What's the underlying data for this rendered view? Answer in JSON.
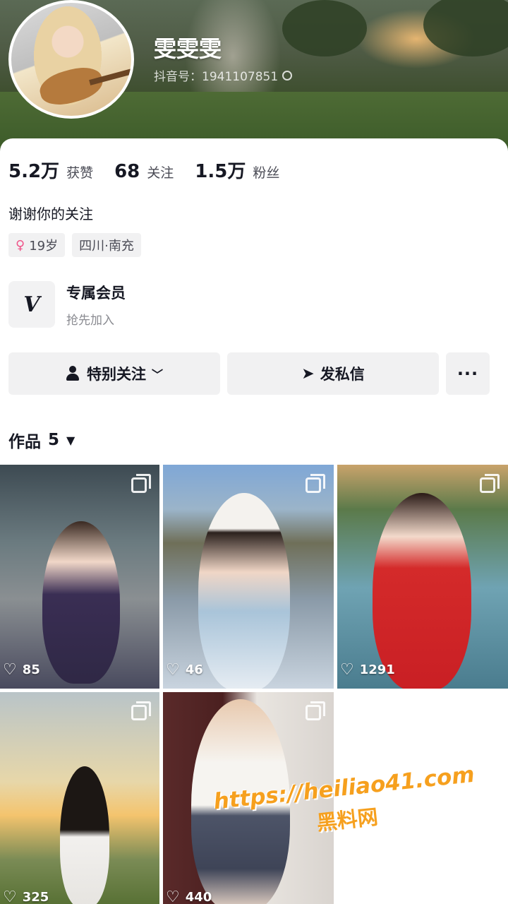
{
  "profile": {
    "username": "雯雯雯",
    "douyin_id": "抖音号：1941107851"
  },
  "stats": [
    {
      "value": "5.2万",
      "label": "获赞"
    },
    {
      "value": "68",
      "label": "关注"
    },
    {
      "value": "1.5万",
      "label": "粉丝"
    }
  ],
  "bio": "谢谢你的关注",
  "tags": {
    "age": "19岁",
    "location": "四川·南充"
  },
  "membership": {
    "logo": "V",
    "title": "专属会员",
    "subtitle": "抢先加入"
  },
  "actions": {
    "follow": "特别关注",
    "message": "发私信",
    "more": "···"
  },
  "works": {
    "label": "作品",
    "count": "5"
  },
  "videos": [
    {
      "likes": "85"
    },
    {
      "likes": "46"
    },
    {
      "likes": "1291"
    },
    {
      "likes": "325"
    },
    {
      "likes": "440"
    }
  ],
  "watermark": {
    "url": "https://heiliao41.com",
    "name": "黑料网"
  },
  "colors": {
    "accent_female": "#f0558a",
    "watermark": "#f6a01e",
    "button_bg": "#f1f1f2",
    "text_primary": "#161823"
  },
  "icons": [
    "copy-icon",
    "female-icon",
    "person-icon",
    "chevron-down-icon",
    "send-icon",
    "more-icon",
    "caret-down-icon",
    "heart-icon",
    "multi-image-icon"
  ]
}
